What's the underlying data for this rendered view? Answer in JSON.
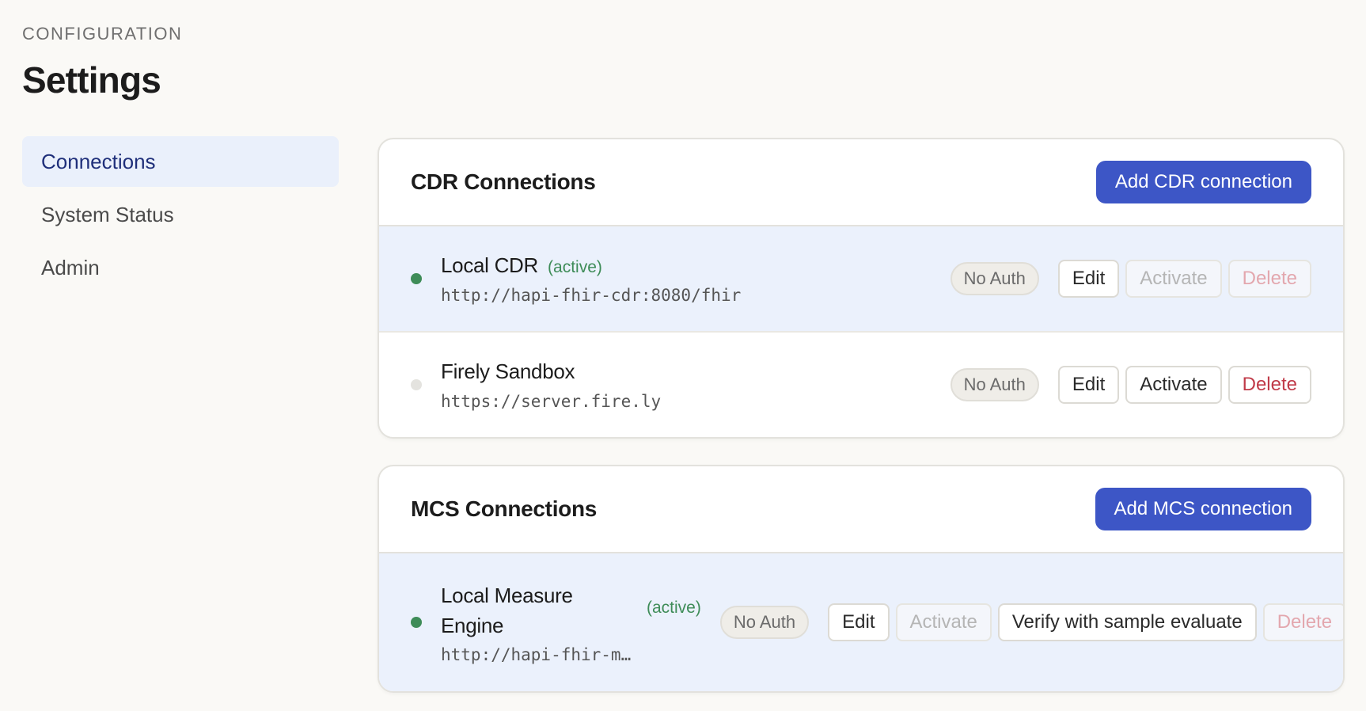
{
  "header": {
    "eyebrow": "CONFIGURATION",
    "title": "Settings"
  },
  "sidebar": {
    "items": [
      {
        "label": "Connections",
        "active": true
      },
      {
        "label": "System Status",
        "active": false
      },
      {
        "label": "Admin",
        "active": false
      }
    ]
  },
  "cdr": {
    "title": "CDR Connections",
    "add_label": "Add CDR connection",
    "rows": [
      {
        "name": "Local CDR",
        "active_label": "(active)",
        "url": "http://hapi-fhir-cdr:8080/fhir",
        "auth": "No Auth",
        "edit": "Edit",
        "activate": "Activate",
        "delete": "Delete"
      },
      {
        "name": "Firely Sandbox",
        "url": "https://server.fire.ly",
        "auth": "No Auth",
        "edit": "Edit",
        "activate": "Activate",
        "delete": "Delete"
      }
    ]
  },
  "mcs": {
    "title": "MCS Connections",
    "add_label": "Add MCS connection",
    "rows": [
      {
        "name_line1": "Local Measure",
        "name_line2": "Engine",
        "active_label": "(active)",
        "url": "http://hapi-fhir-measu…",
        "auth": "No Auth",
        "edit": "Edit",
        "activate": "Activate",
        "verify": "Verify with sample evaluate",
        "delete": "Delete"
      }
    ]
  },
  "colors": {
    "accent": "#3d56c6",
    "active_green": "#3e8c58",
    "danger": "#c03a48",
    "active_row_bg": "#ebf1fc"
  }
}
